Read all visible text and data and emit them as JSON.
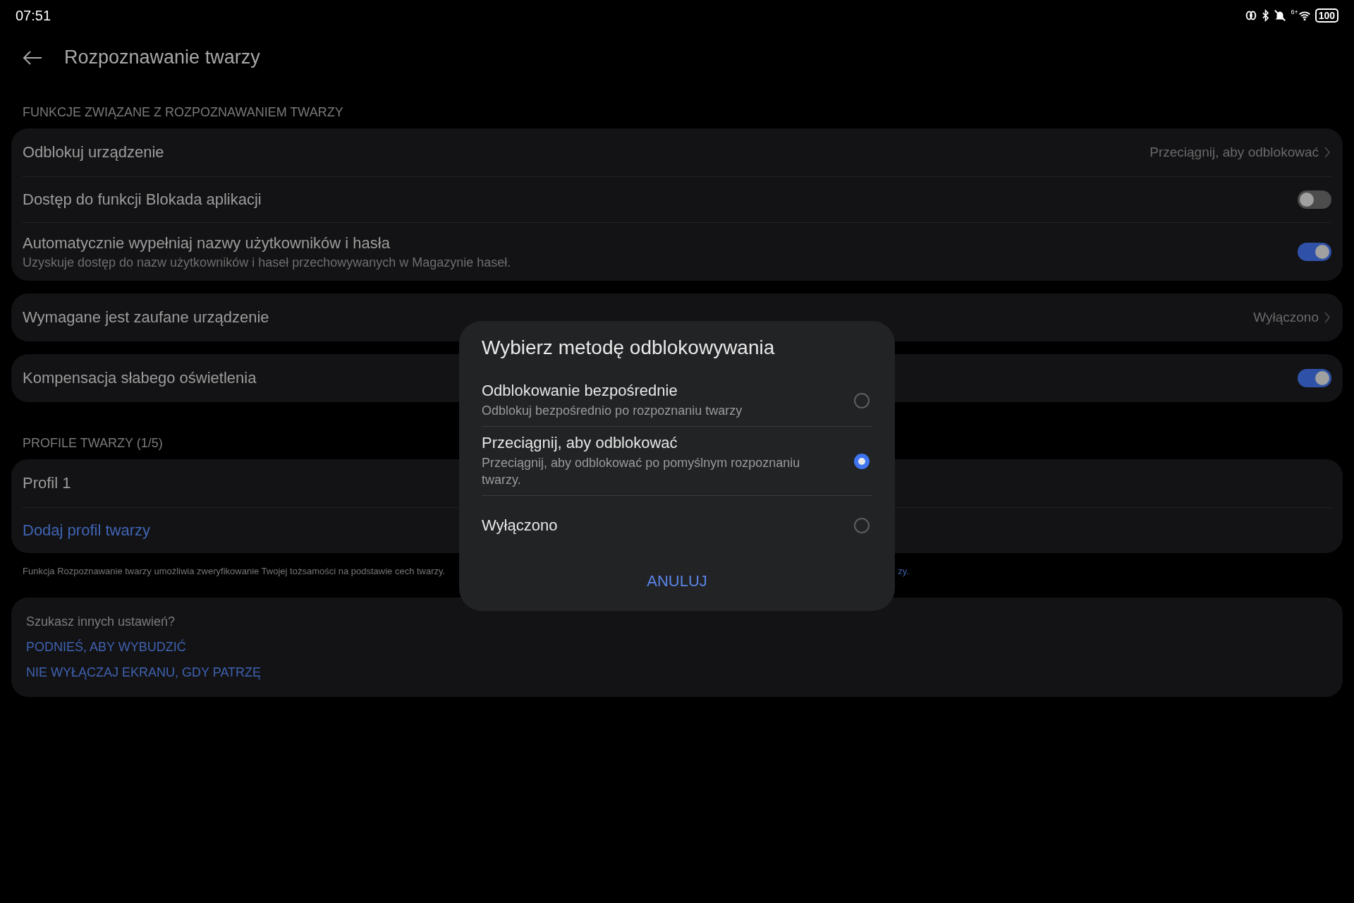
{
  "status_bar": {
    "time": "07:51",
    "wifi_label": "6+",
    "battery": "100"
  },
  "header": {
    "title": "Rozpoznawanie twarzy"
  },
  "sections": [
    {
      "title": "FUNKCJE ZWIĄZANE Z ROZPOZNAWANIEM TWARZY",
      "cards": [
        {
          "rows": [
            {
              "kind": "link",
              "label": "Odblokuj urządzenie",
              "value": "Przeciągnij, aby odblokować"
            },
            {
              "kind": "toggle",
              "label": "Dostęp do funkcji Blokada aplikacji",
              "on": false
            },
            {
              "kind": "toggle",
              "label": "Automatycznie wypełniaj nazwy użytkowników i hasła",
              "subtitle": "Uzyskuje dostęp do nazw użytkowników i haseł przechowywanych w Magazynie haseł.",
              "on": true
            }
          ]
        },
        {
          "rows": [
            {
              "kind": "link",
              "label": "Wymagane jest zaufane urządzenie",
              "value": "Wyłączono"
            }
          ]
        },
        {
          "rows": [
            {
              "kind": "toggle",
              "label": "Kompensacja słabego oświetlenia",
              "on": true
            }
          ]
        }
      ]
    },
    {
      "title": "PROFILE TWARZY (1/5)",
      "cards": [
        {
          "rows": [
            {
              "kind": "plain",
              "label": "Profil 1"
            },
            {
              "kind": "action",
              "label": "Dodaj profil twarzy"
            }
          ]
        }
      ]
    }
  ],
  "footnote": {
    "text": "Funkcja Rozpoznawanie twarzy umożliwia zweryfikowanie Twojej tożsamości na podstawie cech twarzy.",
    "link_tail": "zy."
  },
  "suggestions": {
    "title": "Szukasz innych ustawień?",
    "links": [
      "PODNIEŚ, ABY WYBUDZIĆ",
      "NIE WYŁĄCZAJ EKRANU, GDY PATRZĘ"
    ]
  },
  "dialog": {
    "title": "Wybierz metodę odblokowywania",
    "options": [
      {
        "label": "Odblokowanie bezpośrednie",
        "description": "Odblokuj bezpośrednio po rozpoznaniu twarzy",
        "selected": false
      },
      {
        "label": "Przeciągnij, aby odblokować",
        "description": "Przeciągnij, aby odblokować po pomyślnym rozpoznaniu twarzy.",
        "selected": true
      },
      {
        "label": "Wyłączono",
        "selected": false
      }
    ],
    "cancel": "ANULUJ"
  }
}
